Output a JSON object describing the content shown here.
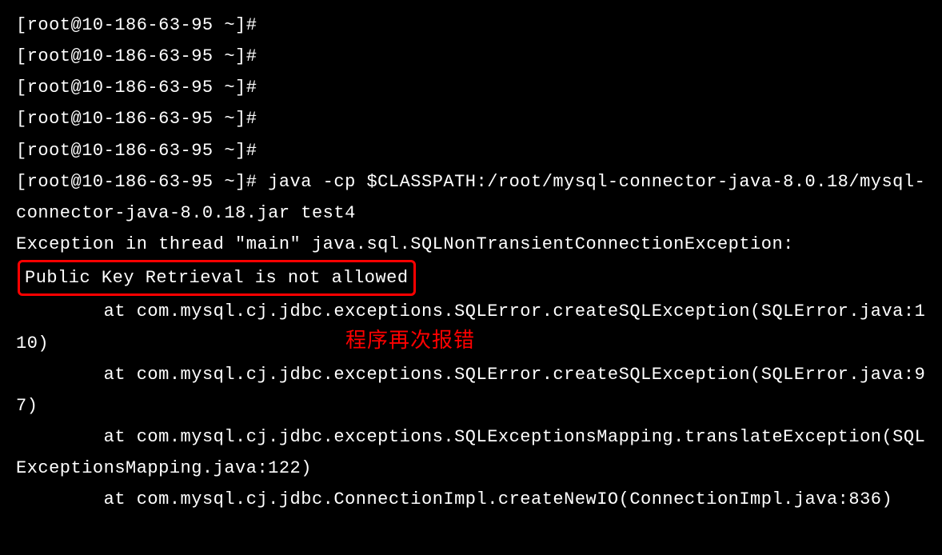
{
  "terminal": {
    "prompt": "[root@10-186-63-95 ~]#",
    "empty_lines_count": 5,
    "command": "java -cp $CLASSPATH:/root/mysql-connector-java-8.0.18/mysql-connector-java-8.0.18.jar test4",
    "exception_prefix": "Exception in thread \"main\" java.sql.SQLNonTransientConnectionException: ",
    "highlighted_error": "Public Key Retrieval is not allowed",
    "stack_trace": [
      "        at com.mysql.cj.jdbc.exceptions.SQLError.createSQLException(SQLError.java:110)",
      "        at com.mysql.cj.jdbc.exceptions.SQLError.createSQLException(SQLError.java:97)",
      "        at com.mysql.cj.jdbc.exceptions.SQLExceptionsMapping.translateException(SQLExceptionsMapping.java:122)",
      "        at com.mysql.cj.jdbc.ConnectionImpl.createNewIO(ConnectionImpl.java:836)"
    ]
  },
  "annotation": {
    "text": "程序再次报错"
  }
}
